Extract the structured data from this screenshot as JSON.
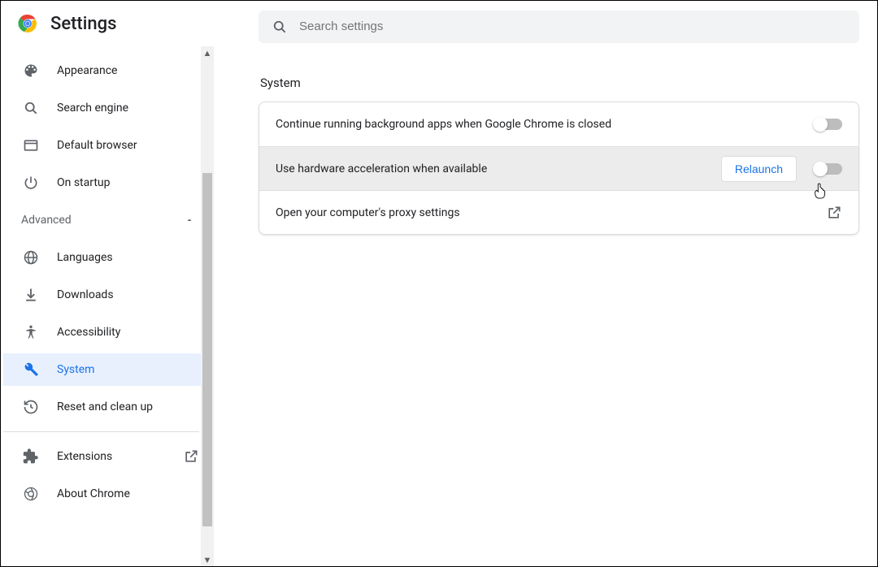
{
  "header": {
    "title": "Settings"
  },
  "search": {
    "placeholder": "Search settings"
  },
  "sidebar": {
    "items": [
      {
        "label": "Appearance"
      },
      {
        "label": "Search engine"
      },
      {
        "label": "Default browser"
      },
      {
        "label": "On startup"
      }
    ],
    "advanced_label": "Advanced",
    "advanced_items": [
      {
        "label": "Languages"
      },
      {
        "label": "Downloads"
      },
      {
        "label": "Accessibility"
      },
      {
        "label": "System"
      },
      {
        "label": "Reset and clean up"
      }
    ],
    "footer_items": [
      {
        "label": "Extensions"
      },
      {
        "label": "About Chrome"
      }
    ]
  },
  "main": {
    "section_title": "System",
    "rows": [
      {
        "label": "Continue running background apps when Google Chrome is closed"
      },
      {
        "label": "Use hardware acceleration when available",
        "relaunch_label": "Relaunch"
      },
      {
        "label": "Open your computer's proxy settings"
      }
    ]
  }
}
